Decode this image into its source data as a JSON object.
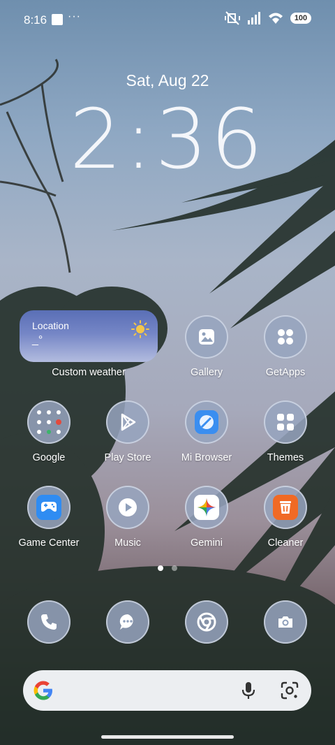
{
  "status_bar": {
    "time": "8:16",
    "more": "···",
    "battery": "100",
    "icons": [
      "media-square-icon",
      "vibrate-off-icon",
      "signal-icon",
      "wifi-icon",
      "battery-icon"
    ]
  },
  "lockclock": {
    "date": "Sat, Aug 22",
    "time": "2:36"
  },
  "weather_widget": {
    "title": "Location",
    "temp": "_°",
    "label": "Custom weather",
    "icon": "sun-icon"
  },
  "apps": [
    {
      "label": "Gallery",
      "icon": "gallery-icon"
    },
    {
      "label": "GetApps",
      "icon": "getapps-icon"
    },
    {
      "label": "Google",
      "icon": "google-folder-icon"
    },
    {
      "label": "Play Store",
      "icon": "play-store-icon"
    },
    {
      "label": "Mi Browser",
      "icon": "mi-browser-icon"
    },
    {
      "label": "Themes",
      "icon": "themes-icon"
    },
    {
      "label": "Game Center",
      "icon": "game-center-icon"
    },
    {
      "label": "Music",
      "icon": "music-icon"
    },
    {
      "label": "Gemini",
      "icon": "gemini-icon"
    },
    {
      "label": "Cleaner",
      "icon": "cleaner-icon"
    }
  ],
  "page_indicator": {
    "pages": 2,
    "current": 1
  },
  "dock": [
    {
      "icon": "phone-icon"
    },
    {
      "icon": "messages-icon"
    },
    {
      "icon": "chrome-icon"
    },
    {
      "icon": "camera-icon"
    }
  ],
  "search_bar": {
    "icons": [
      "google-g-icon",
      "mic-icon",
      "lens-icon"
    ]
  },
  "colors": {
    "icon_bg": "#96a5be",
    "search_bg": "#eceef1",
    "weather_top": "#5a6fb6"
  }
}
